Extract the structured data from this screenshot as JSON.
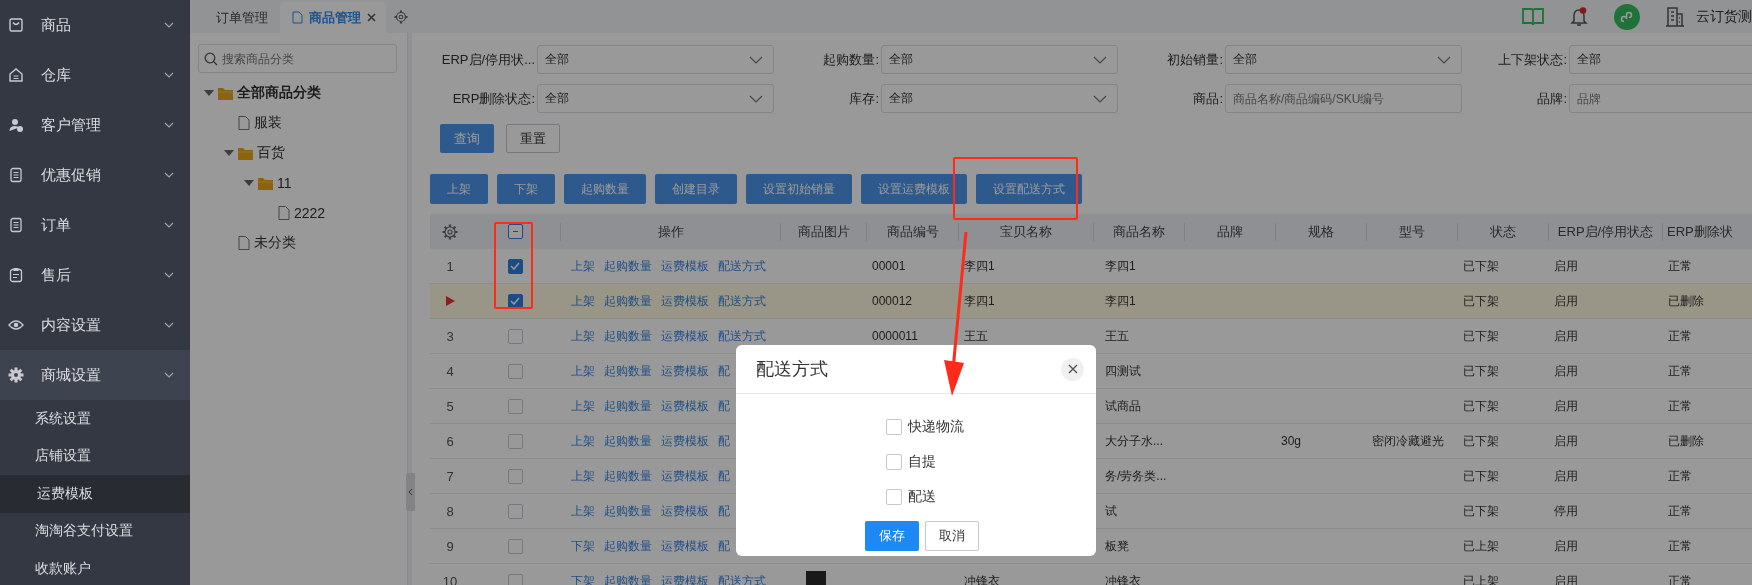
{
  "sidebar": {
    "items": [
      {
        "label": "商品",
        "expanded": false
      },
      {
        "label": "仓库",
        "expanded": false
      },
      {
        "label": "客户管理",
        "expanded": false
      },
      {
        "label": "优惠促销",
        "expanded": false
      },
      {
        "label": "订单",
        "expanded": false
      },
      {
        "label": "售后",
        "expanded": false
      },
      {
        "label": "内容设置",
        "expanded": false
      },
      {
        "label": "商城设置",
        "expanded": true,
        "children": [
          {
            "label": "系统设置",
            "selected": false
          },
          {
            "label": "店铺设置",
            "selected": false
          },
          {
            "label": "运费模板",
            "selected": true
          },
          {
            "label": "淘淘谷支付设置",
            "selected": false
          },
          {
            "label": "收款账户",
            "selected": false
          }
        ]
      }
    ]
  },
  "tabs": [
    {
      "label": "订单管理",
      "selected": false
    },
    {
      "label": "商品管理",
      "selected": true
    }
  ],
  "header": {
    "user": "云订货测",
    "notification_dot": true
  },
  "category_tree": {
    "search": {
      "placeholder": "搜索商品分类"
    },
    "nodes": [
      {
        "label": "全部商品分类",
        "kind": "folder",
        "expanded": true,
        "children": [
          {
            "label": "服装",
            "kind": "file"
          },
          {
            "label": "百货",
            "kind": "folder",
            "expanded": true,
            "children": [
              {
                "label": "11",
                "kind": "folder",
                "expanded": true,
                "children": [
                  {
                    "label": "2222",
                    "kind": "file"
                  }
                ]
              }
            ]
          },
          {
            "label": "未分类",
            "kind": "file"
          }
        ]
      }
    ]
  },
  "filters": [
    {
      "label": "ERP启/停用状...",
      "kind": "select",
      "value": "全部"
    },
    {
      "label": "起购数量:",
      "kind": "select",
      "value": "全部"
    },
    {
      "label": "初始销量:",
      "kind": "select",
      "value": "全部"
    },
    {
      "label": "上下架状态:",
      "kind": "select",
      "value": "全部"
    },
    {
      "label": "ERP删除状态:",
      "kind": "select",
      "value": "全部"
    },
    {
      "label": "库存:",
      "kind": "select",
      "value": "全部"
    },
    {
      "label": "商品:",
      "kind": "input",
      "placeholder": "商品名称/商品编码/SKU编号"
    },
    {
      "label": "品牌:",
      "kind": "input",
      "placeholder": "品牌"
    }
  ],
  "filter_buttons": [
    {
      "label": "查询",
      "kind": "primary"
    },
    {
      "label": "重置",
      "kind": "default"
    }
  ],
  "toolbar": [
    "上架",
    "下架",
    "起购数量",
    "创建目录",
    "设置初始销量",
    "设置运费模板",
    "设置配送方式"
  ],
  "table": {
    "select_all": {
      "indeterminate": true
    },
    "columns": [
      "操作",
      "商品图片",
      "商品编号",
      "宝贝名称",
      "商品名称",
      "品牌",
      "规格",
      "型号",
      "状态",
      "ERP启/停用状态",
      "ERP删除状"
    ],
    "rows": [
      {
        "index": "1",
        "checked": true,
        "current": false,
        "actions": [
          "上架",
          "起购数量",
          "运费模板",
          "配送方式"
        ],
        "code": "00001",
        "title": "李四1",
        "name": "李四1",
        "status": "已下架",
        "erp_status": "启用",
        "erp_deleted": "正常"
      },
      {
        "checked": true,
        "current": true,
        "actions": [
          "上架",
          "起购数量",
          "运费模板",
          "配送方式"
        ],
        "code": "000012",
        "title": "李四1",
        "name": "李四1",
        "status": "已下架",
        "erp_status": "启用",
        "erp_deleted": "已删除"
      },
      {
        "index": "3",
        "checked": false,
        "current": false,
        "actions": [
          "上架",
          "起购数量",
          "运费模板",
          "配送方式"
        ],
        "code": "0000011",
        "title": "王五",
        "name": "王五",
        "status": "已下架",
        "erp_status": "启用",
        "erp_deleted": "正常"
      },
      {
        "index": "4",
        "checked": false,
        "current": false,
        "actions": [
          "上架",
          "起购数量",
          "运费模板",
          "配"
        ],
        "name": "四测试",
        "status": "已下架",
        "erp_status": "启用",
        "erp_deleted": "正常"
      },
      {
        "index": "5",
        "checked": false,
        "current": false,
        "actions": [
          "上架",
          "起购数量",
          "运费模板",
          "配"
        ],
        "name": "试商品",
        "status": "已下架",
        "erp_status": "启用",
        "erp_deleted": "正常"
      },
      {
        "index": "6",
        "checked": false,
        "current": false,
        "actions": [
          "上架",
          "起购数量",
          "运费模板",
          "配"
        ],
        "name": "大分子水...",
        "spec": "30g",
        "model": "密闭冷藏避光",
        "status": "已下架",
        "erp_status": "启用",
        "erp_deleted": "已删除"
      },
      {
        "index": "7",
        "checked": false,
        "current": false,
        "actions": [
          "上架",
          "起购数量",
          "运费模板",
          "配"
        ],
        "name": "务/劳务类...",
        "status": "已下架",
        "erp_status": "启用",
        "erp_deleted": "正常"
      },
      {
        "index": "8",
        "checked": false,
        "current": false,
        "actions": [
          "上架",
          "起购数量",
          "运费模板",
          "配"
        ],
        "name": "试",
        "status": "已下架",
        "erp_status": "停用",
        "erp_deleted": "正常"
      },
      {
        "index": "9",
        "checked": false,
        "current": false,
        "actions": [
          "下架",
          "起购数量",
          "运费模板",
          "配"
        ],
        "name": "板凳",
        "status": "已上架",
        "erp_status": "启用",
        "erp_deleted": "正常"
      },
      {
        "index": "10",
        "checked": false,
        "current": false,
        "actions": [
          "下架",
          "起购数量",
          "运费模板",
          "配送方式"
        ],
        "image": true,
        "title": "冲锋衣",
        "name": "冲锋衣",
        "status": "已上架",
        "erp_status": "启用",
        "erp_deleted": "正常"
      }
    ]
  },
  "dialog": {
    "title": "配送方式",
    "options": [
      {
        "label": "快递物流",
        "checked": false
      },
      {
        "label": "自提",
        "checked": false
      },
      {
        "label": "配送",
        "checked": false
      }
    ],
    "buttons": [
      {
        "label": "保存",
        "kind": "primary"
      },
      {
        "label": "取消",
        "kind": "default"
      }
    ]
  }
}
